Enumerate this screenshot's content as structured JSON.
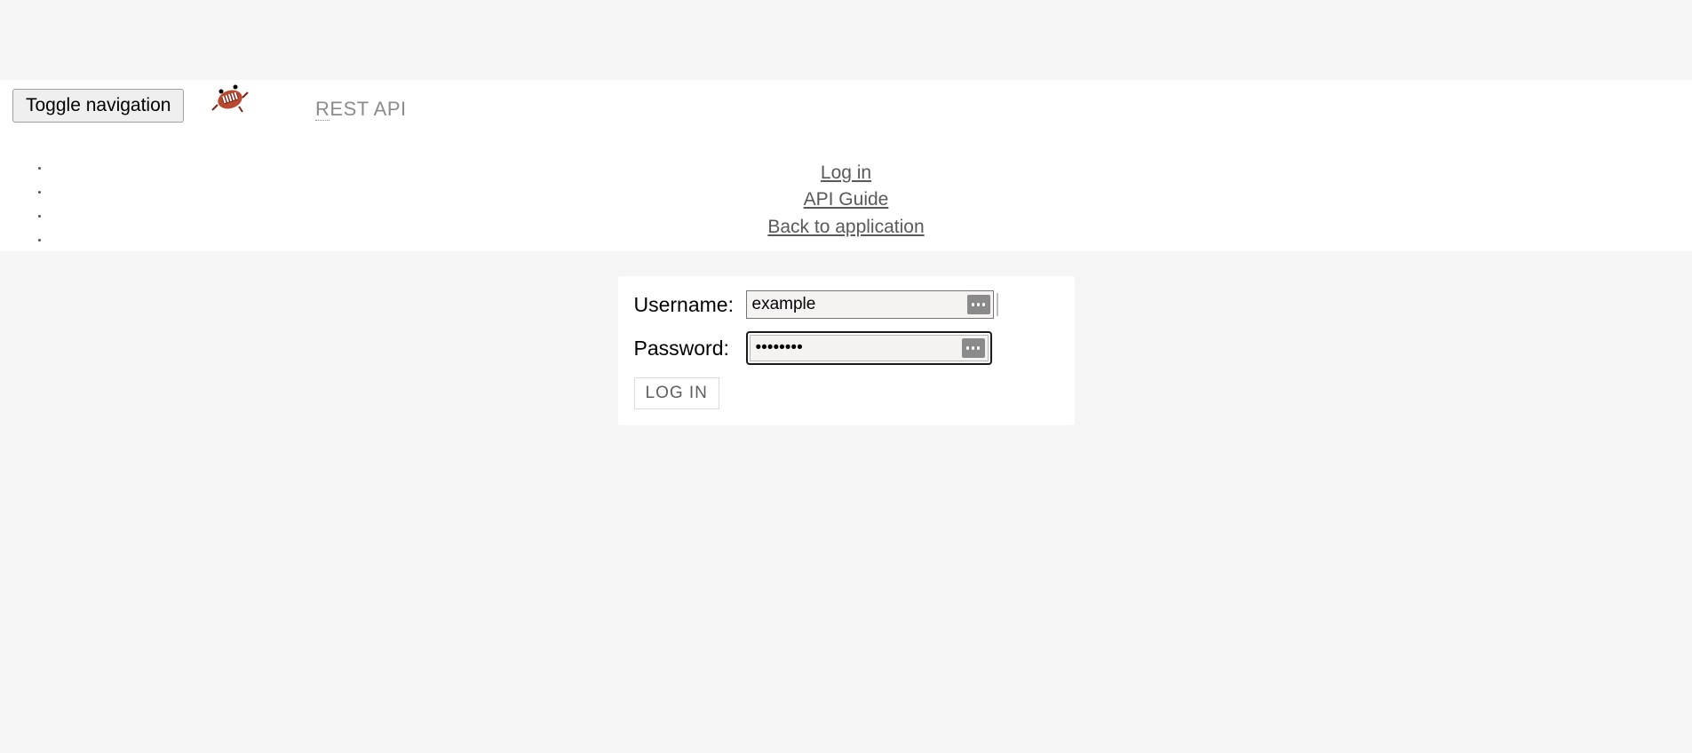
{
  "nav": {
    "toggle_label": "Toggle navigation",
    "brand": "REST API",
    "links": {
      "login": "Log in",
      "api_guide": "API Guide",
      "back": "Back to application"
    }
  },
  "login_form": {
    "username_label": "Username:",
    "username_value": "example",
    "password_label": "Password:",
    "password_value": "••••••••",
    "submit_label": "LOG IN"
  }
}
